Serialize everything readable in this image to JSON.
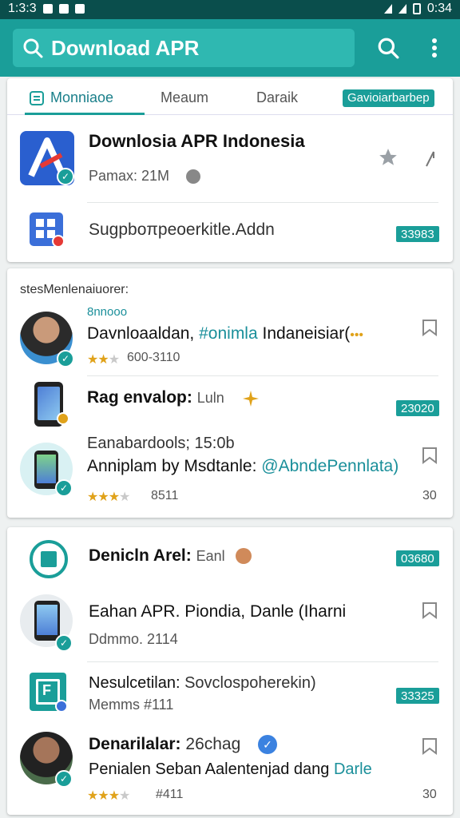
{
  "status_bar": {
    "time_left": "1:3:3",
    "time_right": "0:34"
  },
  "search": {
    "query": "Download APR"
  },
  "tabs": [
    {
      "label": "Monniaoe"
    },
    {
      "label": "Meaum"
    },
    {
      "label": "Daraik"
    },
    {
      "label": "Gavioiarbarbep"
    }
  ],
  "top_card": {
    "app_title": "Downlosia APR Indonesia",
    "app_meta": "Pamax: 21M",
    "secondary_item": "Sugpboπpeoerkitle.Addn",
    "secondary_badge": "33983"
  },
  "section": {
    "label": "stesMenlenaiuorer:",
    "items": [
      {
        "tag": "8nnooo",
        "title_plain": "Davnloaaldan, ",
        "title_link": "#onimla",
        "title_rest": " Indaneisiar(",
        "rating_text": "600-3110",
        "stars": 2
      },
      {
        "title": "Rag envalop:",
        "title_light": "Luln",
        "badge": "23020"
      },
      {
        "subtitle": "Eanabardools; 15:0b",
        "title_plain": "Anniplam by Msdtanle: ",
        "title_link": "@AbndePennlata)",
        "rating_text": "8511",
        "stars": 3,
        "count": "30"
      }
    ]
  },
  "bottom_card": {
    "items": [
      {
        "title": "Denicln Arel:",
        "title_light": "Eanl",
        "badge": "03680"
      },
      {
        "title": "Eahan APR. Piondia,  Danle (Iharni",
        "subtitle": "Ddmmo. 2114"
      },
      {
        "title": "Nesulcetilan:",
        "title_light": " Sovclospoherekin)",
        "subtitle": "Memms #111",
        "badge": "33325"
      },
      {
        "title": "Denarilalar:",
        "title_light": " 26chag",
        "desc_plain": "Penialen Seban Aalentenjad dang ",
        "desc_link": "Darle",
        "rating_text": "#411",
        "stars": 3,
        "count": "30"
      }
    ]
  },
  "colors": {
    "accent": "#1a9e99",
    "appbar": "#1a9e99",
    "statusbar": "#0a4e4c",
    "star": "#e0a21a"
  }
}
